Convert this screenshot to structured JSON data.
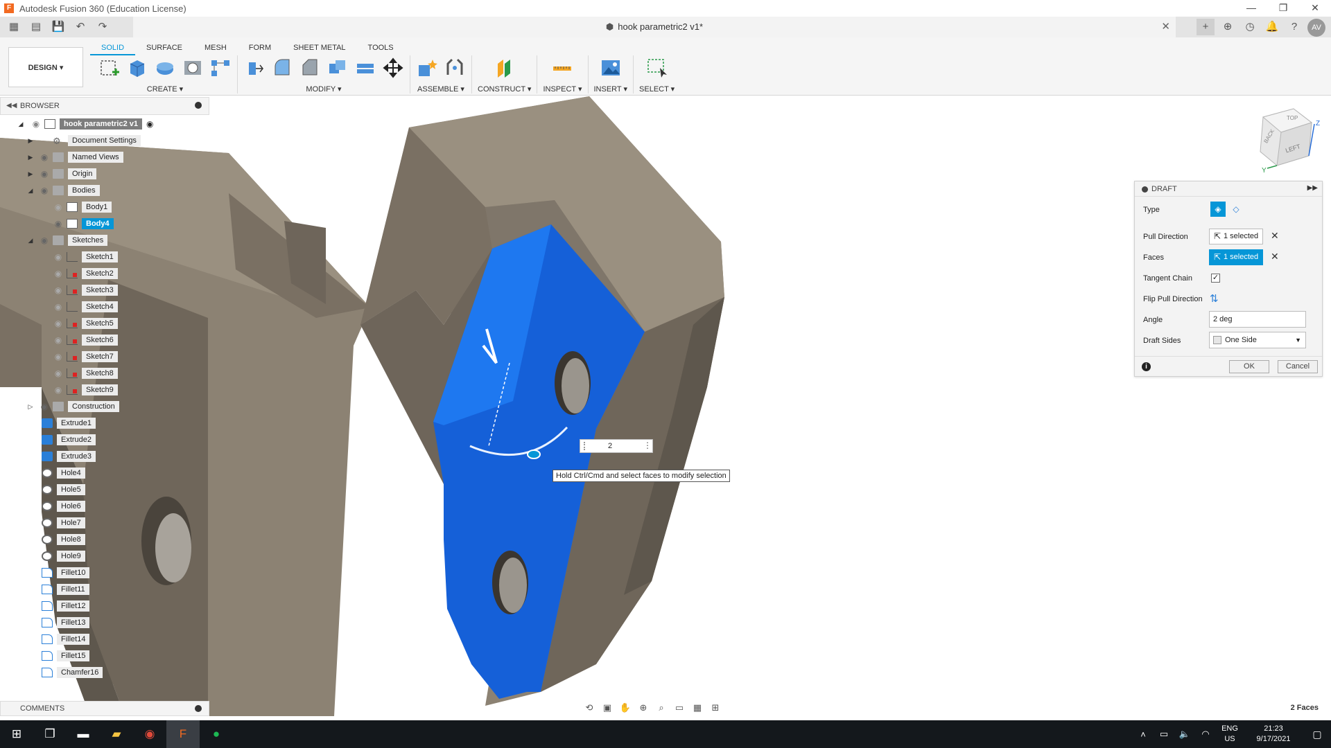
{
  "window": {
    "title": "Autodesk Fusion 360 (Education License)",
    "controls": [
      "—",
      "❐",
      "✕"
    ]
  },
  "quick_access": {
    "icons": [
      "grid-icon",
      "file-icon",
      "save-icon",
      "undo-icon",
      "redo-icon"
    ]
  },
  "document_tab": {
    "title": "hook parametric2 v1*"
  },
  "user": {
    "initials": "AV"
  },
  "ribbon": {
    "tabs": [
      {
        "label": "SOLID",
        "active": true
      },
      {
        "label": "SURFACE",
        "active": false
      },
      {
        "label": "MESH",
        "active": false
      },
      {
        "label": "FORM",
        "active": false
      },
      {
        "label": "SHEET METAL",
        "active": false
      },
      {
        "label": "TOOLS",
        "active": false
      }
    ],
    "workspace": "DESIGN ▾",
    "groups": [
      {
        "label": "CREATE ▾",
        "count": 5
      },
      {
        "label": "MODIFY ▾",
        "count": 6
      },
      {
        "label": "ASSEMBLE ▾",
        "count": 2
      },
      {
        "label": "CONSTRUCT ▾",
        "count": 1
      },
      {
        "label": "INSPECT ▾",
        "count": 1
      },
      {
        "label": "INSERT ▾",
        "count": 1
      },
      {
        "label": "SELECT ▾",
        "count": 1
      }
    ]
  },
  "browser": {
    "title": "BROWSER",
    "root": "hook parametric2 v1",
    "items": [
      {
        "label": "Document Settings",
        "kind": "gear",
        "level": 1,
        "expander": "▶"
      },
      {
        "label": "Named Views",
        "kind": "folder",
        "level": 1,
        "expander": "▶"
      },
      {
        "label": "Origin",
        "kind": "folder",
        "level": 1,
        "expander": "▶"
      },
      {
        "label": "Bodies",
        "kind": "folder",
        "level": 1,
        "expander": "◢"
      },
      {
        "label": "Body1",
        "kind": "body",
        "level": 2
      },
      {
        "label": "Body4",
        "kind": "body",
        "level": 2,
        "selected": true
      },
      {
        "label": "Sketches",
        "kind": "folder",
        "level": 1,
        "expander": "◢"
      },
      {
        "label": "Sketch1",
        "kind": "sketch",
        "level": 2
      },
      {
        "label": "Sketch2",
        "kind": "sketch-red",
        "level": 2
      },
      {
        "label": "Sketch3",
        "kind": "sketch-red",
        "level": 2
      },
      {
        "label": "Sketch4",
        "kind": "sketch",
        "level": 2
      },
      {
        "label": "Sketch5",
        "kind": "sketch-red",
        "level": 2
      },
      {
        "label": "Sketch6",
        "kind": "sketch-red",
        "level": 2
      },
      {
        "label": "Sketch7",
        "kind": "sketch-red",
        "level": 2
      },
      {
        "label": "Sketch8",
        "kind": "sketch-red",
        "level": 2
      },
      {
        "label": "Sketch9",
        "kind": "sketch-red",
        "level": 2
      },
      {
        "label": "Construction",
        "kind": "folder",
        "level": 1,
        "expander": "▷"
      },
      {
        "label": "Extrude1",
        "kind": "feature",
        "level": 0
      },
      {
        "label": "Extrude2",
        "kind": "feature",
        "level": 0
      },
      {
        "label": "Extrude3",
        "kind": "feature",
        "level": 0
      },
      {
        "label": "Hole4",
        "kind": "hole",
        "level": 0
      },
      {
        "label": "Hole5",
        "kind": "hole",
        "level": 0
      },
      {
        "label": "Hole6",
        "kind": "hole",
        "level": 0
      },
      {
        "label": "Hole7",
        "kind": "hole",
        "level": 0
      },
      {
        "label": "Hole8",
        "kind": "hole",
        "level": 0
      },
      {
        "label": "Hole9",
        "kind": "hole",
        "level": 0
      },
      {
        "label": "Fillet10",
        "kind": "fillet",
        "level": 0
      },
      {
        "label": "Fillet11",
        "kind": "fillet",
        "level": 0
      },
      {
        "label": "Fillet12",
        "kind": "fillet",
        "level": 0
      },
      {
        "label": "Fillet13",
        "kind": "fillet",
        "level": 0
      },
      {
        "label": "Fillet14",
        "kind": "fillet",
        "level": 0
      },
      {
        "label": "Fillet15",
        "kind": "fillet",
        "level": 0
      },
      {
        "label": "Chamfer16",
        "kind": "fillet",
        "level": 0
      }
    ]
  },
  "comments": {
    "title": "COMMENTS"
  },
  "draft_dialog": {
    "title": "DRAFT",
    "type_label": "Type",
    "pull_direction_label": "Pull Direction",
    "pull_direction_value": "1 selected",
    "faces_label": "Faces",
    "faces_value": "1 selected",
    "tangent_chain_label": "Tangent Chain",
    "tangent_chain_checked": "✓",
    "flip_pull_direction_label": "Flip Pull Direction",
    "angle_label": "Angle",
    "angle_value": "2 deg",
    "draft_sides_label": "Draft Sides",
    "draft_sides_value": "One Side",
    "ok_label": "OK",
    "cancel_label": "Cancel"
  },
  "viewport": {
    "manipulator_value": "2",
    "tooltip": "Hold Ctrl/Cmd and select faces to modify selection",
    "selection_count": "2 Faces",
    "view_cube_faces": [
      "LEFT",
      "BACK",
      "TOP"
    ],
    "axis_labels": [
      "Z",
      "Y"
    ],
    "colors": {
      "selected_face": "#1560d8",
      "body_light": "#8c8273",
      "body_dark": "#5e574d",
      "accent": "#0696d7"
    }
  },
  "navbar": {
    "icons": [
      "orbit-icon",
      "look-at-icon",
      "pan-icon",
      "zoom-icon",
      "zoom-window-icon",
      "display-settings-icon",
      "grid-settings-icon",
      "viewports-icon"
    ]
  },
  "taskbar": {
    "apps": [
      "windows-start-icon",
      "task-view-icon",
      "terminal-icon",
      "file-explorer-icon",
      "chrome-icon",
      "fusion-icon",
      "spotify-icon"
    ],
    "language_line1": "ENG",
    "language_line2": "US",
    "time": "21:23",
    "date": "9/17/2021"
  }
}
